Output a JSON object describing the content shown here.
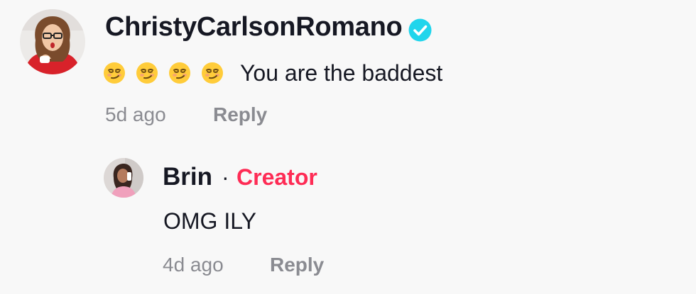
{
  "comment": {
    "username": "ChristyCarlsonRomano",
    "verified": true,
    "emojis": [
      "smirking-face",
      "smirking-face",
      "smirking-face",
      "smirking-face"
    ],
    "text": "You are the baddest",
    "time": "5d ago",
    "reply_label": "Reply"
  },
  "reply": {
    "username": "Brin",
    "separator": "·",
    "badge": "Creator",
    "text": "OMG ILY",
    "time": "4d ago",
    "reply_label": "Reply"
  },
  "colors": {
    "background": "#f8f8f8",
    "text": "#161823",
    "muted": "#8a8b91",
    "creator_badge": "#fe2c55",
    "verified_badge": "#20d5ec"
  }
}
